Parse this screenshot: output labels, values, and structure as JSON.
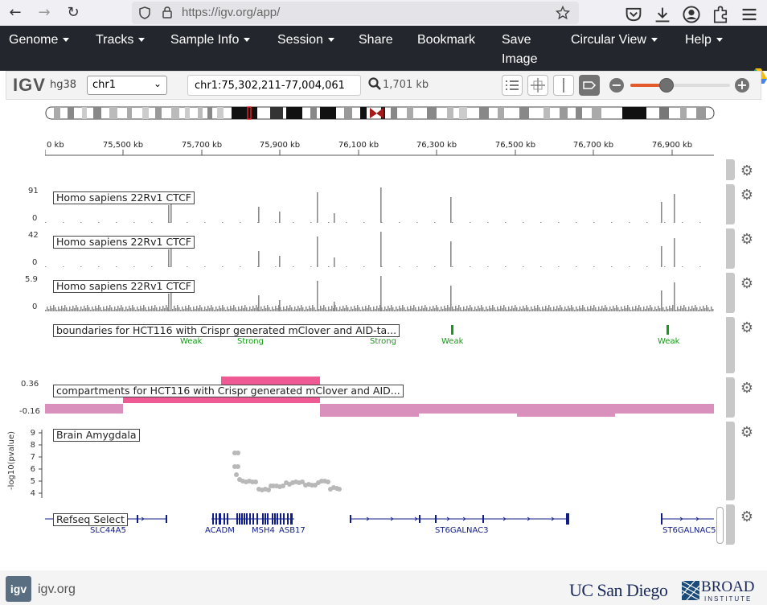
{
  "browser": {
    "url": "https://igv.org/app/"
  },
  "navbar": {
    "items": [
      {
        "label": "Genome",
        "caret": true
      },
      {
        "label": "Tracks",
        "caret": true
      },
      {
        "label": "Sample Info",
        "caret": true
      },
      {
        "label": "Session",
        "caret": true
      },
      {
        "label": "Share",
        "caret": false
      },
      {
        "label": "Bookmark",
        "caret": false
      },
      {
        "label": "Save",
        "caret": false
      },
      {
        "label": "Circular View",
        "caret": true
      },
      {
        "label": "Help",
        "caret": true
      }
    ],
    "save_line2": "Image"
  },
  "toolbar": {
    "logo": "IGV",
    "genome": "hg38",
    "chromosome": "chr1",
    "locus": "chr1:75,302,211-77,004,061",
    "bp_count": "1,701 kb",
    "zoom_level": 0.36
  },
  "ruler": {
    "ticks": [
      "0 kb",
      "75,500 kb",
      "75,700 kb",
      "75,900 kb",
      "76,100 kb",
      "76,300 kb",
      "76,500 kb",
      "76,700 kb",
      "76,900 kb"
    ]
  },
  "tracks": {
    "ctcf1": {
      "name": "Homo sapiens 22Rv1 CTCF",
      "max": "91",
      "min": "0"
    },
    "ctcf2": {
      "name": "Homo sapiens 22Rv1 CTCF",
      "max": "42",
      "min": "0"
    },
    "ctcf3": {
      "name": "Homo sapiens 22Rv1 CTCF",
      "max": "5.9",
      "min": "0"
    },
    "boundaries": {
      "name": "boundaries for HCT116 with Crispr generated mClover and AID-ta...",
      "labels": [
        "Weak",
        "Strong",
        "Strong",
        "Weak",
        "Weak"
      ],
      "color": "#159b16"
    },
    "compartments": {
      "name": "compartments for HCT116 with Crispr generated mClover and AID...",
      "max": "0.36",
      "min": "-0.16",
      "pos_color": "#ef5a94",
      "neg_color": "#d990bd"
    },
    "gwas": {
      "name": "Brain Amygdala",
      "ylabel": "-log10(pvalue)",
      "ticks": [
        "9",
        "8",
        "7",
        "6",
        "5",
        "4"
      ]
    },
    "refseq": {
      "name": "Refseq Select",
      "genes": [
        "SLC44A5",
        "ACADM",
        "MSH4",
        "ASB17",
        "ST6GALNAC3",
        "ST6GALNAC5"
      ],
      "color": "#0f1c89"
    }
  },
  "footer": {
    "site": "igv.org",
    "ucsd": "UC San Diego",
    "broad": "BROAD",
    "broad_sub": "INSTITUTE"
  }
}
